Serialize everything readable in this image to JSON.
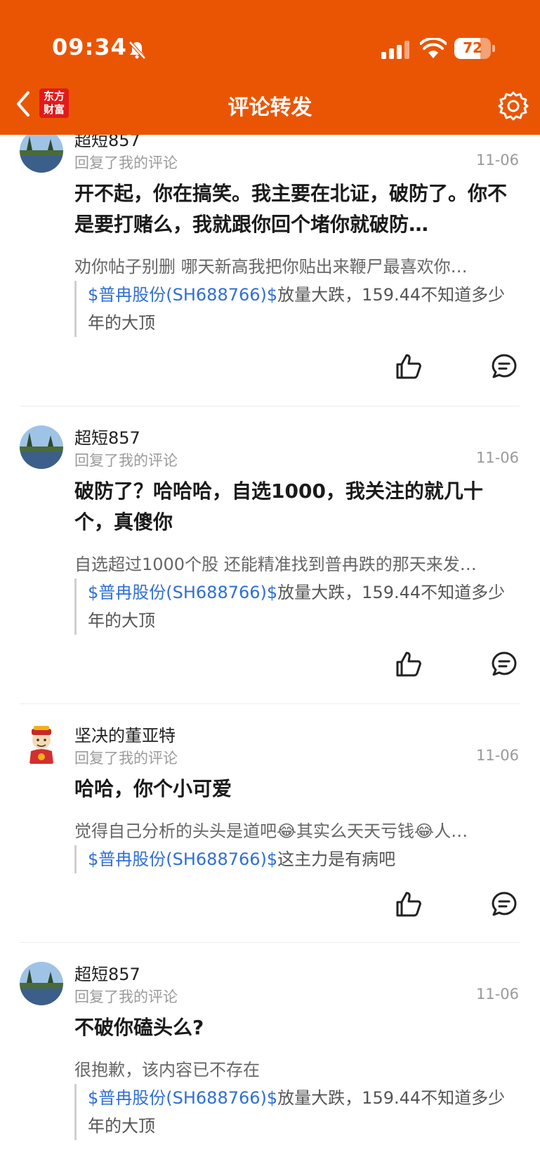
{
  "status_bar": {
    "time": "09:34",
    "battery": "72",
    "battery_level": 0.72
  },
  "nav": {
    "title": "评论转发",
    "logo_text_top": "东方",
    "logo_text_bottom": "财富"
  },
  "comments": [
    {
      "username": "超短857",
      "subtitle": "回复了我的评论",
      "date": "11-06",
      "content": "开不起，你在搞笑。我主要在北证，破防了。你不是要打赌么，我就跟你回个堵你就破防…",
      "quote": "劝你帖子别删 哪天新高我把你贴出来鞭尸最喜欢你…",
      "stock_tag": "$普冉股份(SH688766)$",
      "original_text": "放量大跌，159.44不知道多少年的大顶"
    },
    {
      "username": "超短857",
      "subtitle": "回复了我的评论",
      "date": "11-06",
      "content": "破防了？哈哈哈，自选1000，我关注的就几十个，真傻你",
      "quote": "自选超过1000个股 还能精准找到普冉跌的那天来发…",
      "stock_tag": "$普冉股份(SH688766)$",
      "original_text": "放量大跌，159.44不知道多少年的大顶"
    },
    {
      "username": "坚决的董亚特",
      "subtitle": "回复了我的评论",
      "date": "11-06",
      "content": "哈哈，你个小可爱",
      "quote": "觉得自己分析的头头是道吧😂其实么天天亏钱😂人…",
      "stock_tag": "$普冉股份(SH688766)$",
      "original_text": "这主力是有病吧"
    },
    {
      "username": "超短857",
      "subtitle": "回复了我的评论",
      "date": "11-06",
      "content": "不破你磕头么?",
      "quote": "很抱歉，该内容已不存在",
      "stock_tag": "$普冉股份(SH688766)$",
      "original_text": "放量大跌，159.44不知道多少年的大顶"
    }
  ]
}
